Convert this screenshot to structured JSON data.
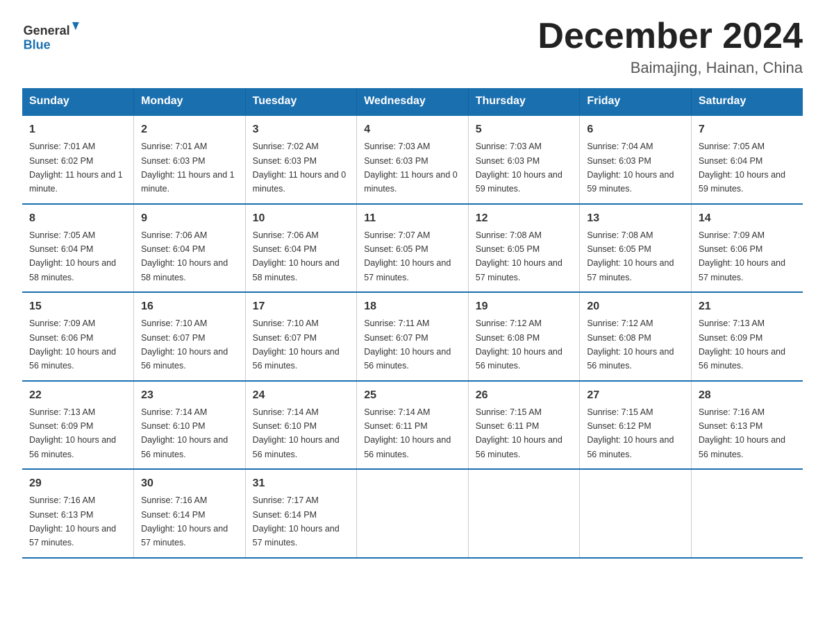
{
  "logo": {
    "general": "General",
    "blue": "Blue"
  },
  "header": {
    "month": "December 2024",
    "location": "Baimajing, Hainan, China"
  },
  "weekdays": [
    "Sunday",
    "Monday",
    "Tuesday",
    "Wednesday",
    "Thursday",
    "Friday",
    "Saturday"
  ],
  "weeks": [
    [
      {
        "day": "1",
        "sunrise": "7:01 AM",
        "sunset": "6:02 PM",
        "daylight": "11 hours and 1 minute."
      },
      {
        "day": "2",
        "sunrise": "7:01 AM",
        "sunset": "6:03 PM",
        "daylight": "11 hours and 1 minute."
      },
      {
        "day": "3",
        "sunrise": "7:02 AM",
        "sunset": "6:03 PM",
        "daylight": "11 hours and 0 minutes."
      },
      {
        "day": "4",
        "sunrise": "7:03 AM",
        "sunset": "6:03 PM",
        "daylight": "11 hours and 0 minutes."
      },
      {
        "day": "5",
        "sunrise": "7:03 AM",
        "sunset": "6:03 PM",
        "daylight": "10 hours and 59 minutes."
      },
      {
        "day": "6",
        "sunrise": "7:04 AM",
        "sunset": "6:03 PM",
        "daylight": "10 hours and 59 minutes."
      },
      {
        "day": "7",
        "sunrise": "7:05 AM",
        "sunset": "6:04 PM",
        "daylight": "10 hours and 59 minutes."
      }
    ],
    [
      {
        "day": "8",
        "sunrise": "7:05 AM",
        "sunset": "6:04 PM",
        "daylight": "10 hours and 58 minutes."
      },
      {
        "day": "9",
        "sunrise": "7:06 AM",
        "sunset": "6:04 PM",
        "daylight": "10 hours and 58 minutes."
      },
      {
        "day": "10",
        "sunrise": "7:06 AM",
        "sunset": "6:04 PM",
        "daylight": "10 hours and 58 minutes."
      },
      {
        "day": "11",
        "sunrise": "7:07 AM",
        "sunset": "6:05 PM",
        "daylight": "10 hours and 57 minutes."
      },
      {
        "day": "12",
        "sunrise": "7:08 AM",
        "sunset": "6:05 PM",
        "daylight": "10 hours and 57 minutes."
      },
      {
        "day": "13",
        "sunrise": "7:08 AM",
        "sunset": "6:05 PM",
        "daylight": "10 hours and 57 minutes."
      },
      {
        "day": "14",
        "sunrise": "7:09 AM",
        "sunset": "6:06 PM",
        "daylight": "10 hours and 57 minutes."
      }
    ],
    [
      {
        "day": "15",
        "sunrise": "7:09 AM",
        "sunset": "6:06 PM",
        "daylight": "10 hours and 56 minutes."
      },
      {
        "day": "16",
        "sunrise": "7:10 AM",
        "sunset": "6:07 PM",
        "daylight": "10 hours and 56 minutes."
      },
      {
        "day": "17",
        "sunrise": "7:10 AM",
        "sunset": "6:07 PM",
        "daylight": "10 hours and 56 minutes."
      },
      {
        "day": "18",
        "sunrise": "7:11 AM",
        "sunset": "6:07 PM",
        "daylight": "10 hours and 56 minutes."
      },
      {
        "day": "19",
        "sunrise": "7:12 AM",
        "sunset": "6:08 PM",
        "daylight": "10 hours and 56 minutes."
      },
      {
        "day": "20",
        "sunrise": "7:12 AM",
        "sunset": "6:08 PM",
        "daylight": "10 hours and 56 minutes."
      },
      {
        "day": "21",
        "sunrise": "7:13 AM",
        "sunset": "6:09 PM",
        "daylight": "10 hours and 56 minutes."
      }
    ],
    [
      {
        "day": "22",
        "sunrise": "7:13 AM",
        "sunset": "6:09 PM",
        "daylight": "10 hours and 56 minutes."
      },
      {
        "day": "23",
        "sunrise": "7:14 AM",
        "sunset": "6:10 PM",
        "daylight": "10 hours and 56 minutes."
      },
      {
        "day": "24",
        "sunrise": "7:14 AM",
        "sunset": "6:10 PM",
        "daylight": "10 hours and 56 minutes."
      },
      {
        "day": "25",
        "sunrise": "7:14 AM",
        "sunset": "6:11 PM",
        "daylight": "10 hours and 56 minutes."
      },
      {
        "day": "26",
        "sunrise": "7:15 AM",
        "sunset": "6:11 PM",
        "daylight": "10 hours and 56 minutes."
      },
      {
        "day": "27",
        "sunrise": "7:15 AM",
        "sunset": "6:12 PM",
        "daylight": "10 hours and 56 minutes."
      },
      {
        "day": "28",
        "sunrise": "7:16 AM",
        "sunset": "6:13 PM",
        "daylight": "10 hours and 56 minutes."
      }
    ],
    [
      {
        "day": "29",
        "sunrise": "7:16 AM",
        "sunset": "6:13 PM",
        "daylight": "10 hours and 57 minutes."
      },
      {
        "day": "30",
        "sunrise": "7:16 AM",
        "sunset": "6:14 PM",
        "daylight": "10 hours and 57 minutes."
      },
      {
        "day": "31",
        "sunrise": "7:17 AM",
        "sunset": "6:14 PM",
        "daylight": "10 hours and 57 minutes."
      },
      null,
      null,
      null,
      null
    ]
  ]
}
